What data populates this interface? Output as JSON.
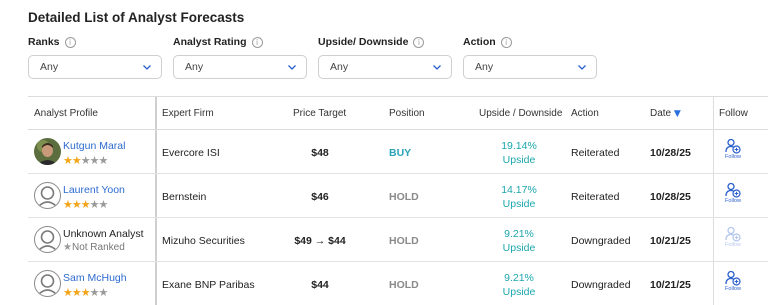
{
  "title": "Detailed List of Analyst Forecasts",
  "filters": [
    {
      "label": "Ranks",
      "value": "Any"
    },
    {
      "label": "Analyst Rating",
      "value": "Any"
    },
    {
      "label": "Upside/ Downside",
      "value": "Any"
    },
    {
      "label": "Action",
      "value": "Any"
    }
  ],
  "columns": {
    "analyst": "Analyst Profile",
    "firm": "Expert Firm",
    "price_target": "Price Target",
    "position": "Position",
    "upside": "Upside / Downside",
    "action": "Action",
    "date": "Date",
    "follow": "Follow"
  },
  "sort_indicator": "▼",
  "follow_label": "Follow",
  "not_ranked_label": "Not Ranked",
  "colors": {
    "link": "#2d6bd1",
    "upside": "#1ca6ad",
    "buy": "#2aa3b7",
    "hold": "#8a8a8a",
    "star": "#f2a516",
    "sort": "#2a6fdb"
  },
  "rows": [
    {
      "name": "Kutgun Maral",
      "stars_filled": 2,
      "stars_total": 5,
      "firm": "Evercore ISI",
      "price_target": "$48",
      "position": "BUY",
      "upside_value": "19.14%",
      "upside_label": "Upside",
      "action": "Reiterated",
      "date": "10/28/25",
      "avatar": "photo",
      "followable": true
    },
    {
      "name": "Laurent Yoon",
      "stars_filled": 3,
      "stars_total": 5,
      "firm": "Bernstein",
      "price_target": "$46",
      "position": "HOLD",
      "upside_value": "14.17%",
      "upside_label": "Upside",
      "action": "Reiterated",
      "date": "10/28/25",
      "avatar": "generic",
      "followable": true
    },
    {
      "name": "Unknown Analyst",
      "stars_filled": 0,
      "stars_total": 0,
      "firm": "Mizuho Securities",
      "price_target": "$49 → $44",
      "position": "HOLD",
      "upside_value": "9.21%",
      "upside_label": "Upside",
      "action": "Downgraded",
      "date": "10/21/25",
      "avatar": "generic",
      "followable": false
    },
    {
      "name": "Sam McHugh",
      "stars_filled": 3,
      "stars_total": 5,
      "firm": "Exane BNP Paribas",
      "price_target": "$44",
      "position": "HOLD",
      "upside_value": "9.21%",
      "upside_label": "Upside",
      "action": "Downgraded",
      "date": "10/21/25",
      "avatar": "generic",
      "followable": true
    }
  ]
}
